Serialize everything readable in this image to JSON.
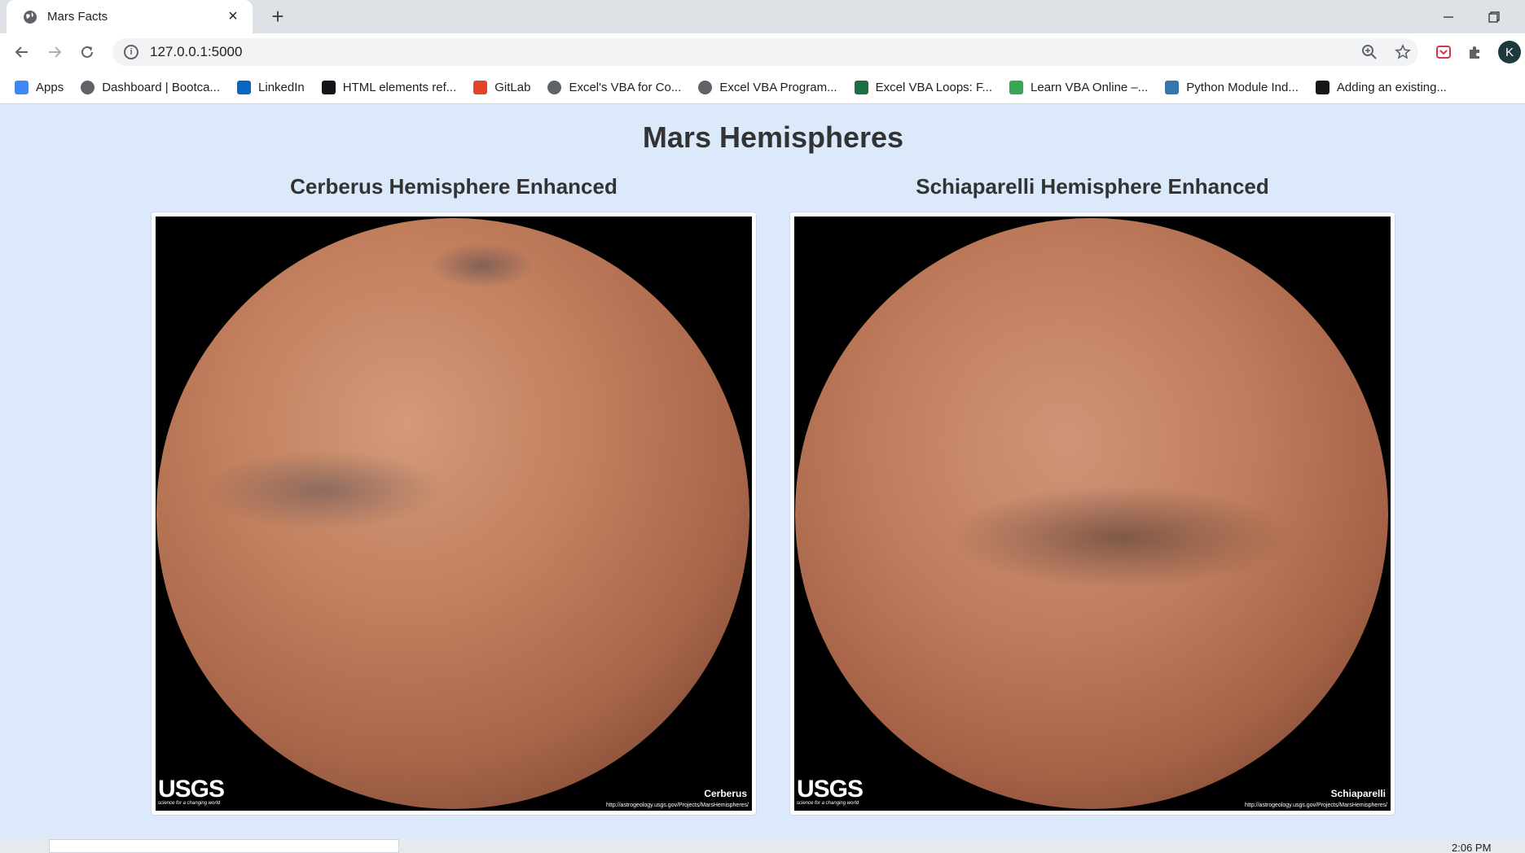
{
  "browser": {
    "tab_title": "Mars Facts",
    "tab_close": "×",
    "new_tab": "+",
    "url": "127.0.0.1:5000"
  },
  "bookmarks": [
    {
      "label": "Apps",
      "icon": "apps-grid-icon",
      "color": "#4285f4"
    },
    {
      "label": "Dashboard | Bootca...",
      "icon": "globe-icon",
      "color": "#5f6368"
    },
    {
      "label": "LinkedIn",
      "icon": "linkedin-icon",
      "color": "#0a66c2"
    },
    {
      "label": "HTML elements ref...",
      "icon": "mdn-icon",
      "color": "#15141a"
    },
    {
      "label": "GitLab",
      "icon": "gitlab-icon",
      "color": "#e24329"
    },
    {
      "label": "Excel's VBA for Co...",
      "icon": "globe-icon",
      "color": "#5f6368"
    },
    {
      "label": "Excel VBA Program...",
      "icon": "globe-icon",
      "color": "#5f6368"
    },
    {
      "label": "Excel VBA Loops: F...",
      "icon": "excel-icon",
      "color": "#1d6f42"
    },
    {
      "label": "Learn VBA Online –...",
      "icon": "gear-icon",
      "color": "#34a853"
    },
    {
      "label": "Python Module Ind...",
      "icon": "python-icon",
      "color": "#3776ab"
    },
    {
      "label": "Adding an existing...",
      "icon": "github-icon",
      "color": "#181717"
    }
  ],
  "profile_initial": "K",
  "page": {
    "title": "Mars Hemispheres",
    "hemispheres": [
      {
        "title": "Cerberus Hemisphere Enhanced",
        "image_name": "Cerberus",
        "image_url": "http://astrogeology.usgs.gov/Projects/MarsHemispheres/",
        "logo": "USGS",
        "logo_tagline": "science for a changing world"
      },
      {
        "title": "Schiaparelli Hemisphere Enhanced",
        "image_name": "Schiaparelli",
        "image_url": "http://astrogeology.usgs.gov/Projects/MarsHemispheres/",
        "logo": "USGS",
        "logo_tagline": "science for a changing world"
      }
    ]
  },
  "taskbar": {
    "clock": "2:06 PM"
  }
}
